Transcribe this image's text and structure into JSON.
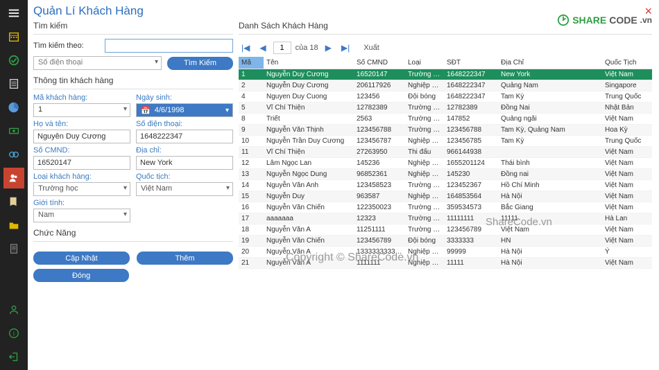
{
  "pageTitle": "Quản Lí Khách Hàng",
  "search": {
    "section": "Tìm kiếm",
    "labelBy": "Tìm kiếm theo:",
    "filterSelected": "Số điện thoại",
    "buttonLabel": "Tìm Kiếm"
  },
  "info": {
    "section": "Thông tin khách hàng",
    "fields": {
      "id_label": "Mã khách hàng:",
      "id_value": "1",
      "dob_label": "Ngày sinh:",
      "dob_value": "4/6/1998",
      "name_label": "Họ và tên:",
      "name_value": "Nguyễn Duy Cương",
      "phone_label": "Số điện thoại:",
      "phone_value": "1648222347",
      "cmnd_label": "Số CMND:",
      "cmnd_value": "16520147",
      "addr_label": "Địa chỉ:",
      "addr_value": "New York",
      "type_label": "Loại khách hàng:",
      "type_value": "Trường học",
      "nat_label": "Quốc tịch:",
      "nat_value": "Việt Nam",
      "gender_label": "Giới tính:",
      "gender_value": "Nam"
    }
  },
  "actions": {
    "section": "Chức Năng",
    "update": "Cập Nhật",
    "add": "Thêm",
    "close": "Đóng"
  },
  "list": {
    "section": "Danh Sách Khách Hàng",
    "pager": {
      "page": "1",
      "of_label": "của 18",
      "export": "Xuất"
    },
    "columns": [
      "Mã",
      "Tên",
      "Số CMND",
      "Loại",
      "SĐT",
      "Địa Chỉ",
      "Quốc Tịch"
    ],
    "rows": [
      {
        "id": "1",
        "name": "Nguyễn Duy Cương",
        "cmnd": "16520147",
        "type": "Trường …",
        "phone": "1648222347",
        "addr": "New York",
        "nat": "Việt Nam",
        "selected": true
      },
      {
        "id": "2",
        "name": "Nguyễn Duy Cương",
        "cmnd": "206117926",
        "type": "Nghiệp …",
        "phone": "1648222347",
        "addr": "Quảng Nam",
        "nat": "Singapore"
      },
      {
        "id": "4",
        "name": "Nguyen Duy Cuong",
        "cmnd": "123456",
        "type": "Đội bóng",
        "phone": "1648222347",
        "addr": "Tam Kỳ",
        "nat": "Trung Quốc"
      },
      {
        "id": "5",
        "name": "Vĩ Chí Thiện",
        "cmnd": "12782389",
        "type": "Trường …",
        "phone": "12782389",
        "addr": "Đồng Nai",
        "nat": "Nhật Bản"
      },
      {
        "id": "8",
        "name": "Triết",
        "cmnd": "2563",
        "type": "Trường …",
        "phone": "147852",
        "addr": "Quảng ngãi",
        "nat": "Việt Nam"
      },
      {
        "id": "9",
        "name": "Nguyễn Văn Thịnh",
        "cmnd": "123456788",
        "type": "Trường …",
        "phone": "123456788",
        "addr": "Tam Kỳ,  Quảng Nam",
        "nat": "Hoa Kỳ"
      },
      {
        "id": "10",
        "name": "Nguyễn Trần Duy Cương",
        "cmnd": "123456787",
        "type": "Nghiệp …",
        "phone": "123456785",
        "addr": "Tam Kỳ",
        "nat": "Trung Quốc"
      },
      {
        "id": "11",
        "name": "Vĩ Chí Thiện",
        "cmnd": "27263950",
        "type": "Thi đấu",
        "phone": "966144938",
        "addr": "",
        "nat": "Việt Nam"
      },
      {
        "id": "12",
        "name": "Lâm Ngọc Lan",
        "cmnd": "145236",
        "type": "Nghiệp …",
        "phone": "1655201124",
        "addr": "Thái bình",
        "nat": "Việt Nam"
      },
      {
        "id": "13",
        "name": "Nguyễn Ngọc Dung",
        "cmnd": "96852361",
        "type": "Nghiệp …",
        "phone": "145230",
        "addr": "Đồng nai",
        "nat": "Việt Nam"
      },
      {
        "id": "14",
        "name": "Nguyễn Văn Anh",
        "cmnd": "123458523",
        "type": "Trường …",
        "phone": "123452367",
        "addr": "Hồ Chí Minh",
        "nat": "Việt Nam"
      },
      {
        "id": "15",
        "name": "Nguyễn Duy",
        "cmnd": "963587",
        "type": "Nghiệp …",
        "phone": "164853564",
        "addr": "Hà Nội",
        "nat": "Việt Nam"
      },
      {
        "id": "16",
        "name": "Nguyễn Văn Chiến",
        "cmnd": "122350023",
        "type": "Trường …",
        "phone": "359534573",
        "addr": "Bắc Giang",
        "nat": "Việt Nam"
      },
      {
        "id": "17",
        "name": "aaaaaaa",
        "cmnd": "12323",
        "type": "Trường …",
        "phone": "11111111",
        "addr": "11111",
        "nat": "Hà Lan"
      },
      {
        "id": "18",
        "name": "Nguyễn Văn A",
        "cmnd": "11251111",
        "type": "Trường …",
        "phone": "123456789",
        "addr": "Việt Nam",
        "nat": "Việt Nam"
      },
      {
        "id": "19",
        "name": "Nguyễn Văn Chiến",
        "cmnd": "123456789",
        "type": "Đội bóng",
        "phone": "3333333",
        "addr": "HN",
        "nat": "Việt Nam"
      },
      {
        "id": "20",
        "name": "Nguyễn Văn A",
        "cmnd": "1333333333…",
        "type": "Nghiệp …",
        "phone": "99999",
        "addr": "Hà Nội",
        "nat": "Ý"
      },
      {
        "id": "21",
        "name": "Nguyễn Văn A",
        "cmnd": "1111111",
        "type": "Nghiệp …",
        "phone": "11111",
        "addr": "Hà Nội",
        "nat": "Việt Nam"
      }
    ]
  },
  "logo": {
    "share": "SHARE",
    "code": "CODE",
    "vn": ".vn"
  },
  "watermark1": "ShareCode.vn",
  "watermark2": "Copyright © ShareCode.vn"
}
